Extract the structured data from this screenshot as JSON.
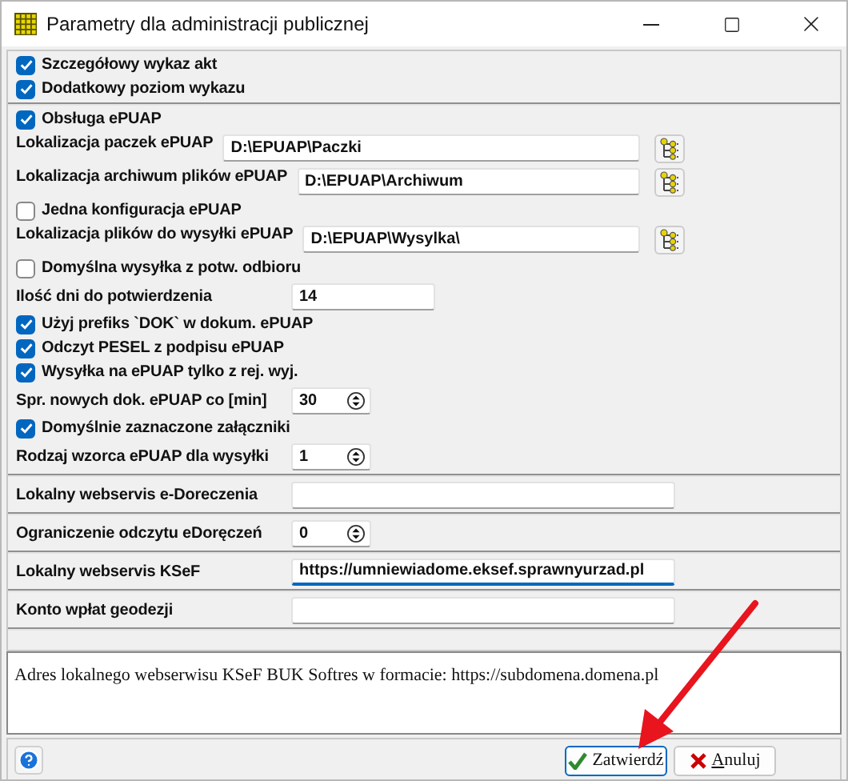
{
  "window": {
    "title": "Parametry dla administracji publicznej"
  },
  "sections": [
    {
      "rows": [
        {
          "kind": "checkbox",
          "label": "Szczegółowy wykaz akt",
          "checked": true
        },
        {
          "kind": "checkbox",
          "label": "Dodatkowy poziom wykazu",
          "checked": true
        }
      ]
    },
    {
      "rows": [
        {
          "kind": "checkbox",
          "label": "Obsługa ePUAP",
          "checked": true
        },
        {
          "kind": "path",
          "label": "Lokalizacja paczek ePUAP",
          "value": "D:\\EPUAP\\Paczki"
        },
        {
          "kind": "path",
          "label": "Lokalizacja archiwum plików ePUAP",
          "value": "D:\\EPUAP\\Archiwum"
        },
        {
          "kind": "checkbox",
          "label": "Jedna konfiguracja ePUAP",
          "checked": false
        },
        {
          "kind": "path",
          "label": "Lokalizacja plików do wysyłki ePUAP",
          "value": "D:\\EPUAP\\Wysylka\\"
        },
        {
          "kind": "checkbox",
          "label": "Domyślna wysyłka z potw. odbioru",
          "checked": false
        },
        {
          "kind": "number",
          "label": "Ilość dni do potwierdzenia",
          "value": "14"
        },
        {
          "kind": "checkbox",
          "label": "Użyj prefiks `DOK` w dokum. ePUAP",
          "checked": true
        },
        {
          "kind": "checkbox",
          "label": "Odczyt PESEL z podpisu ePUAP",
          "checked": true
        },
        {
          "kind": "checkbox",
          "label": "Wysyłka na ePUAP tylko z rej. wyj.",
          "checked": true
        },
        {
          "kind": "spin",
          "label": "Spr. nowych dok. ePUAP co [min]",
          "value": "30"
        },
        {
          "kind": "checkbox",
          "label": "Domyślnie zaznaczone załączniki",
          "checked": true
        },
        {
          "kind": "spin",
          "label": "Rodzaj wzorca ePUAP dla wysyłki",
          "value": "1"
        }
      ]
    },
    {
      "rows": [
        {
          "kind": "text",
          "label": "Lokalny webservis e-Doreczenia",
          "focused": false
        }
      ]
    },
    {
      "rows": [
        {
          "kind": "spin",
          "label": "Ograniczenie odczytu eDoręczeń",
          "value": "0"
        }
      ]
    },
    {
      "rows": [
        {
          "kind": "text",
          "label": "Lokalny webservis KSeF",
          "value": "https://umniewiadome.eksef.sprawnyurzad.pl",
          "focused": true
        }
      ]
    },
    {
      "rows": [
        {
          "kind": "text",
          "label": "Konto wpłat geodezji",
          "focused": false
        }
      ]
    }
  ],
  "hint": "Adres lokalnego webserwisu KSeF BUK Softres w formacie: https://subdomena.domena.pl",
  "buttons": [
    {
      "kind": "ok",
      "label": "Zatwierdź",
      "focused": true,
      "first_letter_underlined": false
    },
    {
      "kind": "cancel",
      "label": "Anuluj",
      "focused": false,
      "first_letter_underlined": true
    }
  ]
}
